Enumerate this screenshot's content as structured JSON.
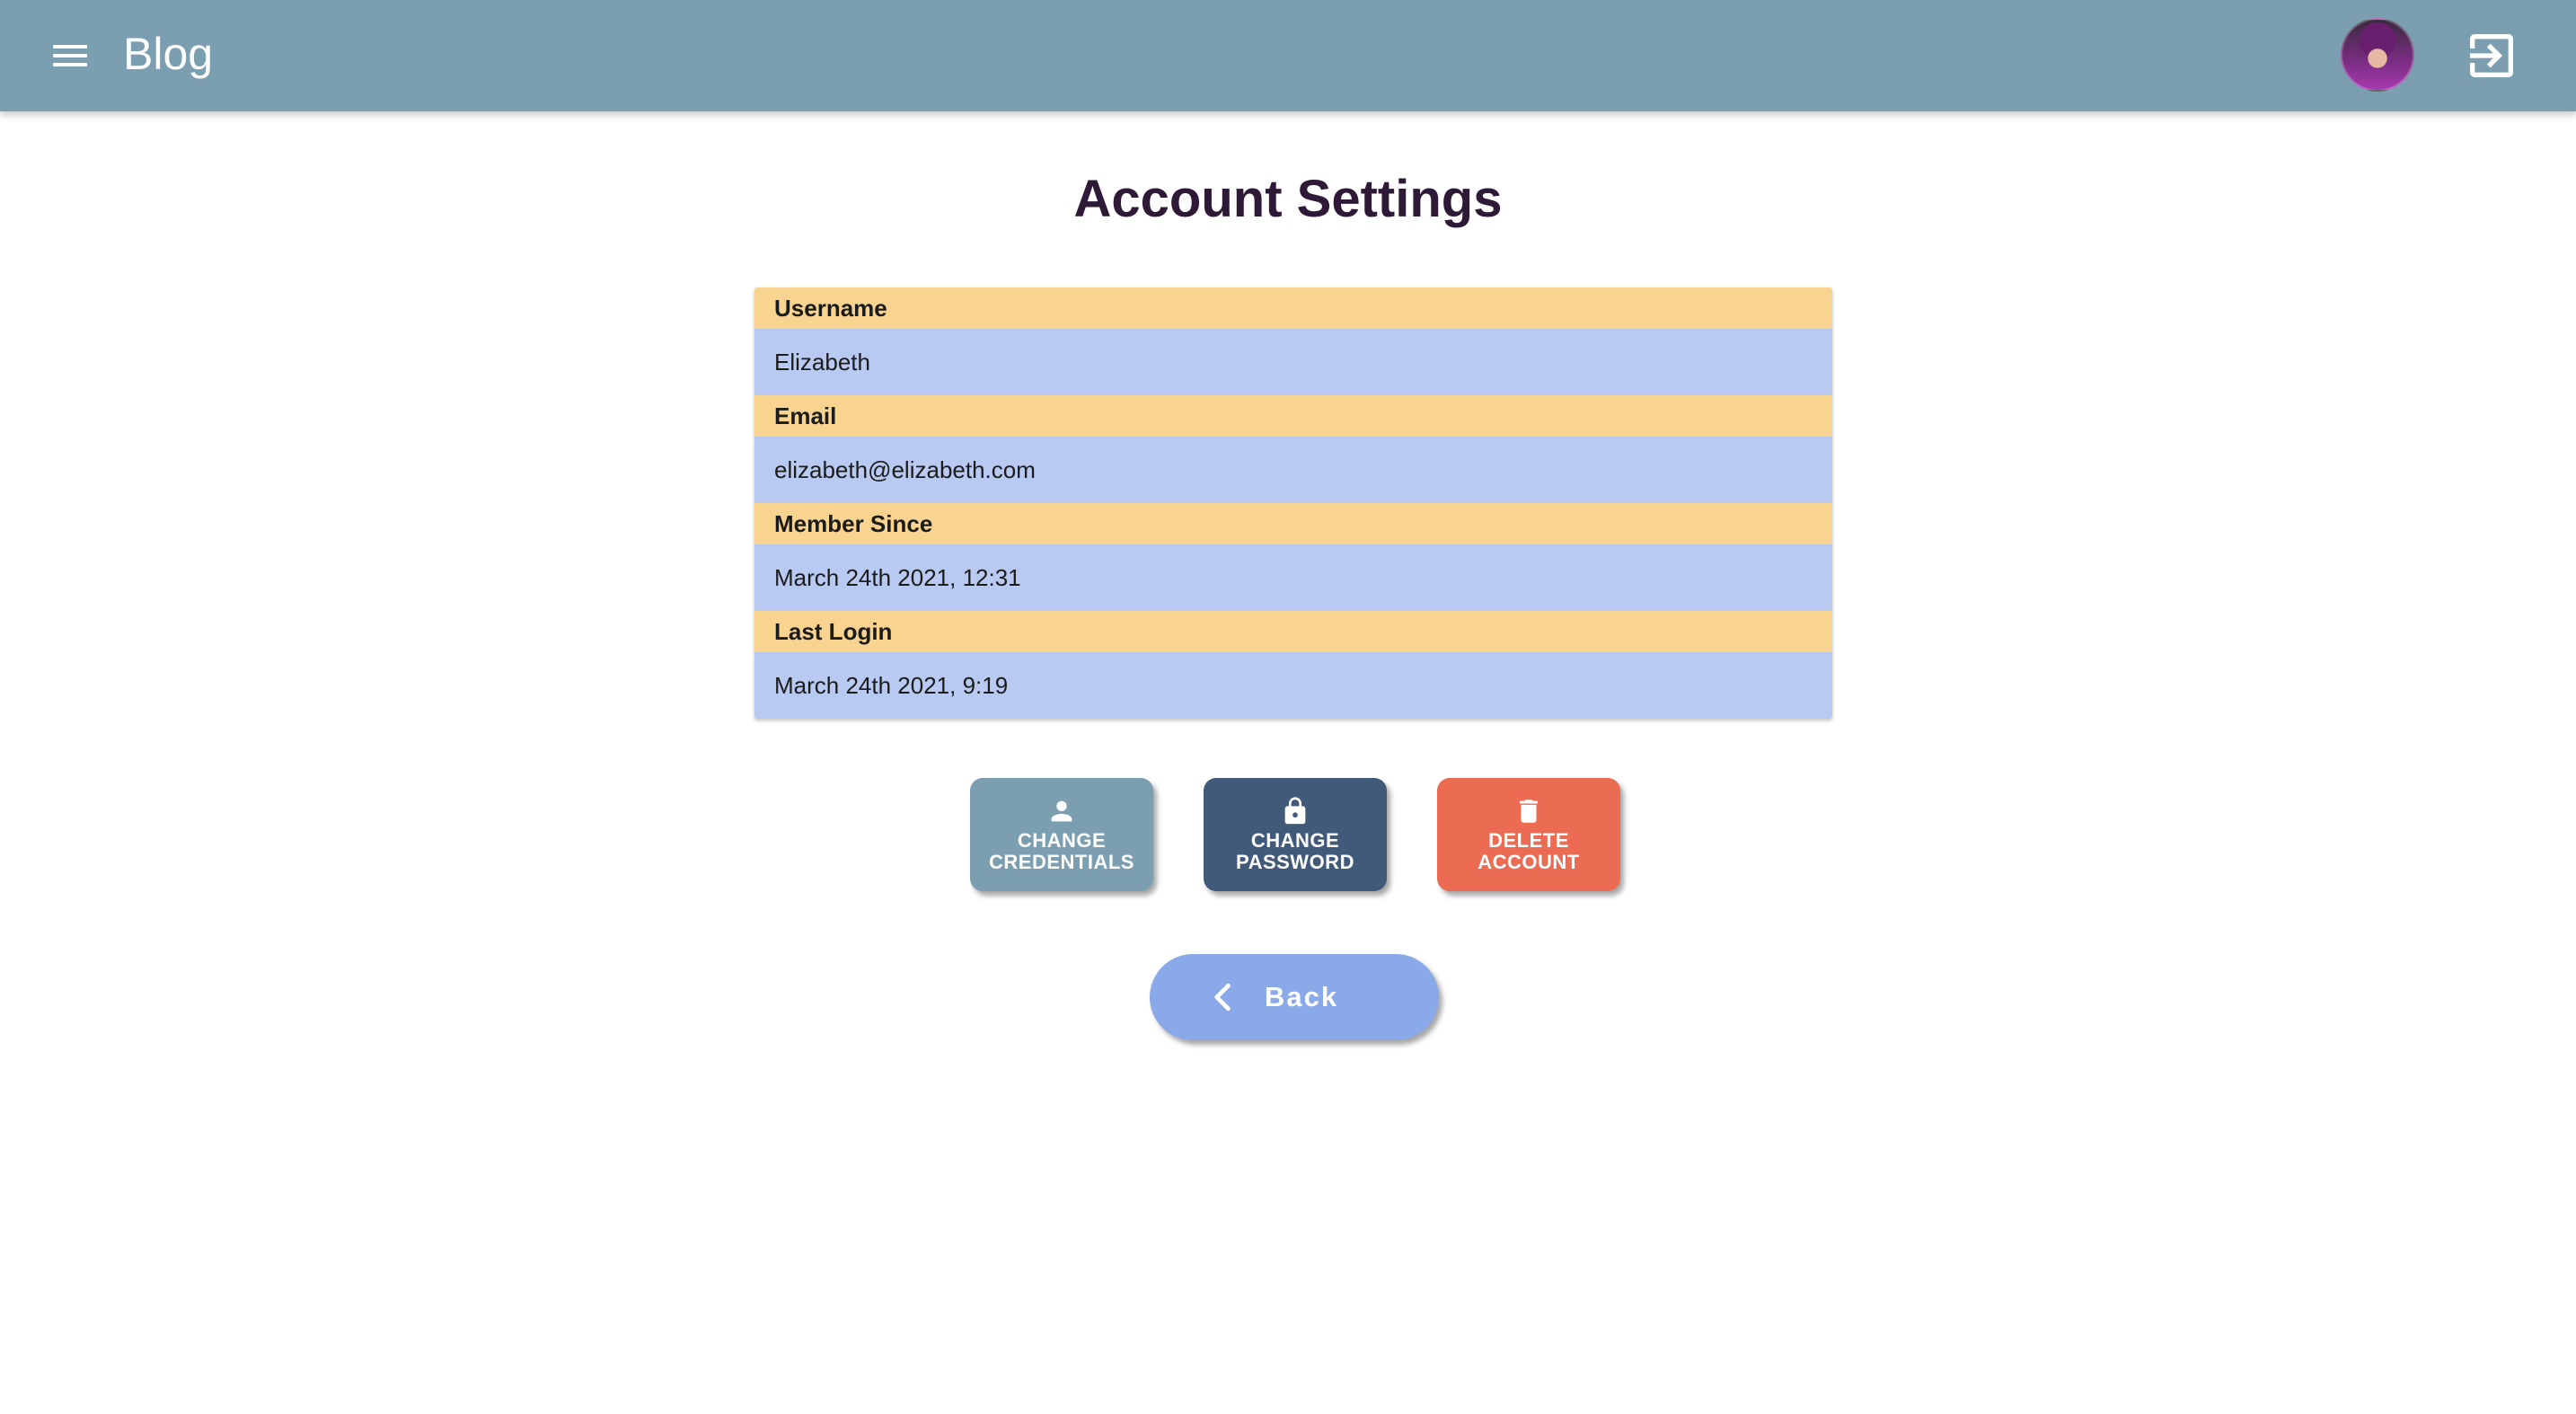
{
  "appbar": {
    "title": "Blog"
  },
  "page": {
    "title": "Account Settings"
  },
  "account": {
    "fields": [
      {
        "label": "Username",
        "value": "Elizabeth"
      },
      {
        "label": "Email",
        "value": "elizabeth@elizabeth.com"
      },
      {
        "label": "Member Since",
        "value": "March 24th 2021, 12:31"
      },
      {
        "label": "Last Login",
        "value": "March 24th 2021, 9:19"
      }
    ]
  },
  "actions": {
    "change_credentials": {
      "line1": "CHANGE",
      "line2": "CREDENTIALS",
      "icon": "person-icon"
    },
    "change_password": {
      "line1": "CHANGE",
      "line2": "PASSWORD",
      "icon": "lock-icon"
    },
    "delete_account": {
      "line1": "DELETE",
      "line2": "ACCOUNT",
      "icon": "trash-icon"
    }
  },
  "back": {
    "label": "Back",
    "icon": "chevron-left-icon"
  },
  "colors": {
    "appbar": "#7b9eb0",
    "label_row": "#f8d490",
    "value_row": "#b8caf1",
    "change_credentials": "#7b9eb0",
    "change_password": "#415a7a",
    "delete_account": "#ec6c53",
    "back": "#89a9e8"
  }
}
